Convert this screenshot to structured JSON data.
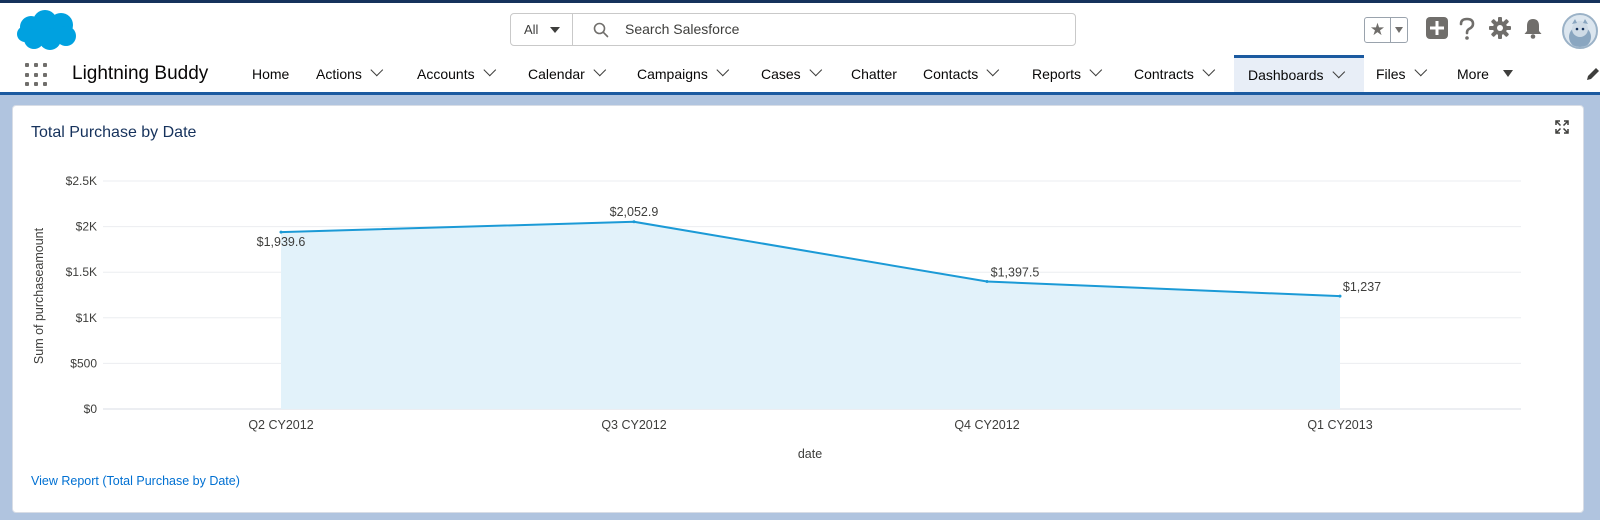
{
  "header": {
    "search": {
      "scope": "All",
      "placeholder": "Search Salesforce"
    },
    "icons": [
      "salesforce-logo",
      "search-icon",
      "favorites-star-icon",
      "add-icon",
      "help-icon",
      "gear-icon",
      "bell-icon",
      "avatar"
    ]
  },
  "nav": {
    "app_name": "Lightning Buddy",
    "items": [
      {
        "label": "Home"
      },
      {
        "label": "Actions"
      },
      {
        "label": "Accounts"
      },
      {
        "label": "Calendar"
      },
      {
        "label": "Campaigns"
      },
      {
        "label": "Cases"
      },
      {
        "label": "Chatter"
      },
      {
        "label": "Contacts"
      },
      {
        "label": "Reports"
      },
      {
        "label": "Contracts"
      },
      {
        "label": "Dashboards",
        "active": true
      },
      {
        "label": "Files"
      },
      {
        "label": "More"
      }
    ]
  },
  "card": {
    "title": "Total Purchase by Date",
    "link": "View Report (Total Purchase by Date)"
  },
  "chart_data": {
    "type": "area",
    "title": "Total Purchase by Date",
    "xlabel": "date",
    "ylabel": "Sum of purchaseamount",
    "categories": [
      "Q2 CY2012",
      "Q3 CY2012",
      "Q4 CY2012",
      "Q1 CY2013"
    ],
    "series": [
      {
        "values": [
          1939.6,
          2052.9,
          1397.5,
          1237
        ],
        "labels": [
          "$1,939.6",
          "$2,052.9",
          "$1,397.5",
          "$1,237"
        ]
      }
    ],
    "ylim": [
      0,
      2500
    ],
    "yticks": [
      {
        "value": 0,
        "label": "$0"
      },
      {
        "value": 500,
        "label": "$500"
      },
      {
        "value": 1000,
        "label": "$1K"
      },
      {
        "value": 1500,
        "label": "$1.5K"
      },
      {
        "value": 2000,
        "label": "$2K"
      },
      {
        "value": 2500,
        "label": "$2.5K"
      }
    ],
    "grid": true,
    "colors": {
      "line": "#1b9ad6",
      "fill": "#e2f2fa"
    }
  }
}
